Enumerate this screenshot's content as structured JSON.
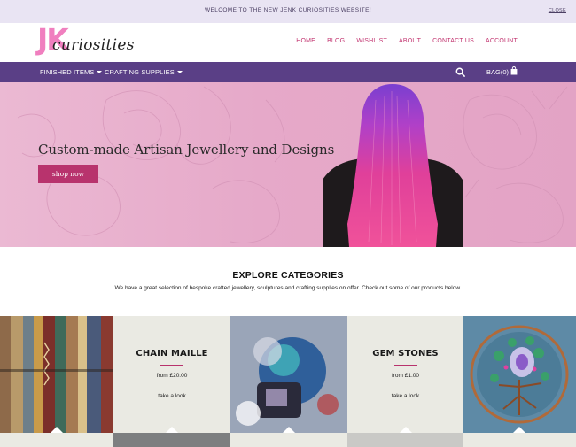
{
  "announcement": {
    "text": "WELCOME TO THE NEW JENK CURIOSITIES WEBSITE!",
    "close": "CLOSE"
  },
  "logo": {
    "mark": "JK",
    "script": "curiosities"
  },
  "topnav": [
    "HOME",
    "BLOG",
    "WISHLIST",
    "ABOUT",
    "CONTACT US",
    "ACCOUNT"
  ],
  "mainnav": {
    "finished": "FINISHED ITEMS",
    "supplies": "CRAFTING SUPPLIES",
    "bag": "BAG(0)"
  },
  "hero": {
    "title": "Custom-made Artisan Jewellery and Designs",
    "button": "shop now"
  },
  "explore": {
    "title": "EXPLORE CATEGORIES",
    "description": "We have a great selection of bespoke crafted jewellery, sculptures and crafting supplies on offer. Check out some of our products below."
  },
  "categories": [
    {
      "name": "CHAIN MAILLE",
      "price": "from  £20.00",
      "link": "take a look"
    },
    {
      "name": "GEM STONES",
      "price": "from  £1.00",
      "link": "take a look"
    }
  ],
  "colors": {
    "accent": "#b8336d",
    "nav": "#5a3f86",
    "logo_pink": "#f07fbf",
    "tile_bg": "#eaeae3"
  }
}
